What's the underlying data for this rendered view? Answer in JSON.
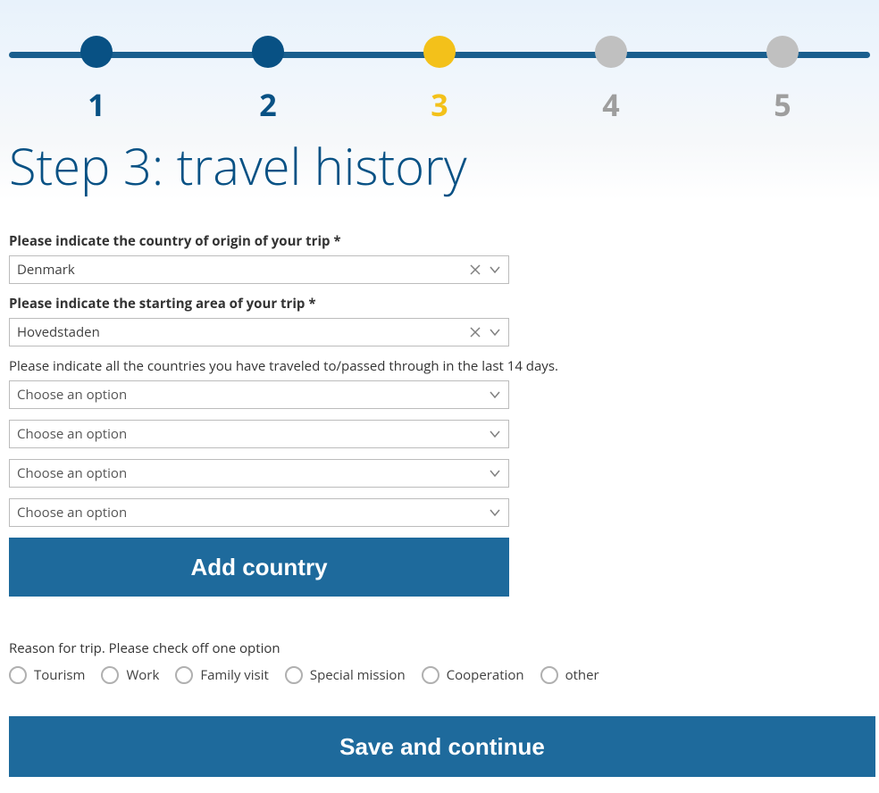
{
  "stepper": {
    "steps": [
      {
        "num": "1",
        "state": "completed"
      },
      {
        "num": "2",
        "state": "completed"
      },
      {
        "num": "3",
        "state": "current"
      },
      {
        "num": "4",
        "state": "future"
      },
      {
        "num": "5",
        "state": "future"
      }
    ]
  },
  "title": "Step 3: travel history",
  "origin_country": {
    "label": "Please indicate the country of origin of your trip *",
    "value": "Denmark"
  },
  "starting_area": {
    "label": "Please indicate the starting area of your trip *",
    "value": "Hovedstaden"
  },
  "travel_14days": {
    "label": "Please indicate all the countries you have traveled to/passed through in the last 14 days.",
    "placeholder": "Choose an option",
    "slots": 4
  },
  "add_country_label": "Add country",
  "reason": {
    "label": "Reason for trip. Please check off one option",
    "options": [
      "Tourism",
      "Work",
      "Family visit",
      "Special mission",
      "Cooperation",
      "other"
    ]
  },
  "save_label": "Save and continue"
}
